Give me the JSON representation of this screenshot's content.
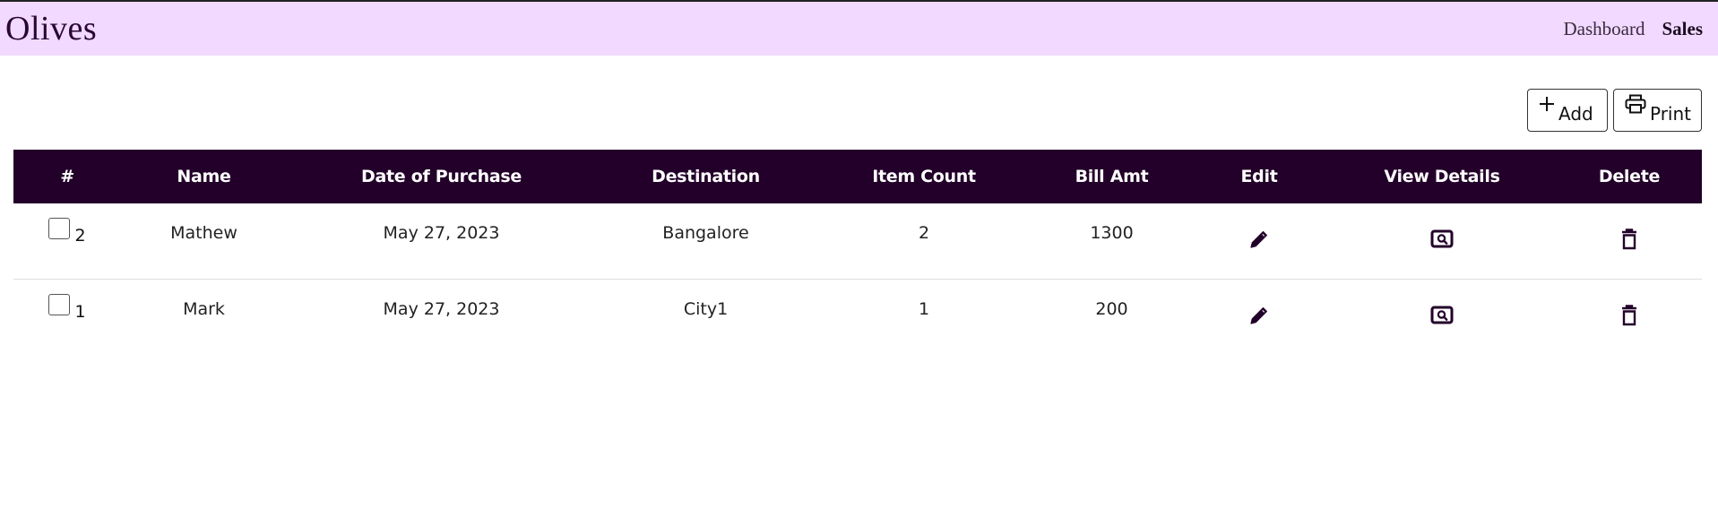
{
  "app": {
    "brand": "Olives"
  },
  "nav": {
    "links": [
      "Dashboard",
      "Sales"
    ],
    "active": "Sales"
  },
  "toolbar": {
    "add_label": "Add",
    "print_label": "Print"
  },
  "table": {
    "headers": [
      "#",
      "Name",
      "Date of Purchase",
      "Destination",
      "Item Count",
      "Bill Amt",
      "Edit",
      "View Details",
      "Delete"
    ],
    "rows": [
      {
        "id": "2",
        "name": "Mathew",
        "date": "May 27, 2023",
        "destination": "Bangalore",
        "item_count": "2",
        "bill_amt": "1300"
      },
      {
        "id": "1",
        "name": "Mark",
        "date": "May 27, 2023",
        "destination": "City1",
        "item_count": "1",
        "bill_amt": "200"
      }
    ]
  },
  "icons": {
    "edit": "pencil-icon",
    "view": "search-document-icon",
    "delete": "trash-icon",
    "add": "plus-icon",
    "print": "printer-icon"
  },
  "colors": {
    "navbar_bg": "#f1d9ff",
    "table_header_bg": "#23002a",
    "icon_color": "#23002a"
  }
}
